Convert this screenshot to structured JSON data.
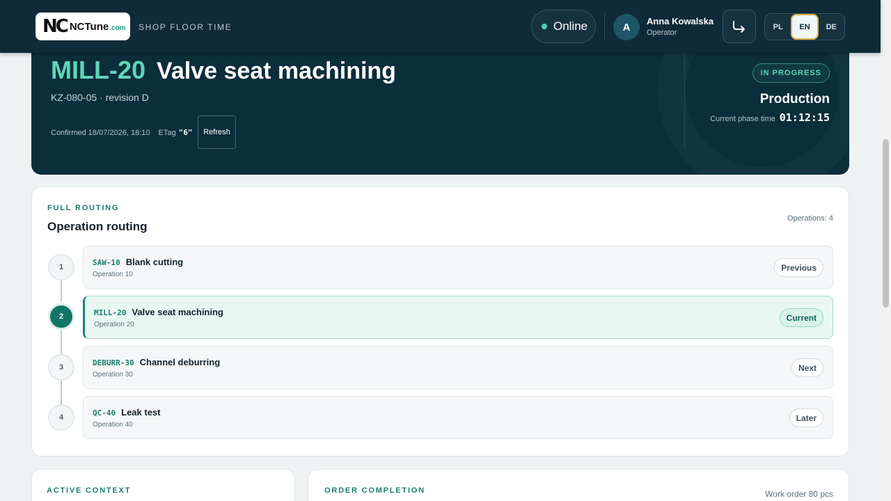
{
  "header": {
    "logo_mark": "NC",
    "logo_text": "NCTune",
    "logo_domain": ".com",
    "subtitle": "SHOP FLOOR TIME",
    "connection_status": "Online",
    "user": {
      "initial": "A",
      "name": "Anna Kowalska",
      "role": "Operator"
    },
    "languages": [
      {
        "code": "PL",
        "active": false
      },
      {
        "code": "EN",
        "active": true
      },
      {
        "code": "DE",
        "active": false
      }
    ]
  },
  "hero": {
    "operation_code": "MILL-20",
    "operation_name": "Valve seat machining",
    "part_info": "KZ-080-05 · revision D",
    "confirmed": "Confirmed 18/07/2026, 18:10",
    "etag_label": "ETag",
    "etag_value": "\"6\"",
    "refresh_label": "Refresh",
    "status": "IN PROGRESS",
    "phase": "Production",
    "phase_time_label": "Current phase time",
    "phase_time": "01:12:15"
  },
  "routing": {
    "eyebrow": "FULL ROUTING",
    "title": "Operation routing",
    "count_label": "Operations: 4",
    "operations": [
      {
        "step": "1",
        "code": "SAW-10",
        "name": "Blank cutting",
        "sub": "Operation 10",
        "badge": "Previous"
      },
      {
        "step": "2",
        "code": "MILL-20",
        "name": "Valve seat machining",
        "sub": "Operation 20",
        "badge": "Current"
      },
      {
        "step": "3",
        "code": "DEBURR-30",
        "name": "Channel deburring",
        "sub": "Operation 30",
        "badge": "Next"
      },
      {
        "step": "4",
        "code": "QC-40",
        "name": "Leak test",
        "sub": "Operation 40",
        "badge": "Later"
      }
    ]
  },
  "context": {
    "eyebrow": "ACTIVE CONTEXT"
  },
  "completion": {
    "eyebrow": "ORDER COMPLETION",
    "work_order": "Work order 80 pcs"
  },
  "colors": {
    "accent": "#1b7c6c",
    "navy": "#0f2a38",
    "status_teal": "#5fd6b8",
    "lang_focus": "#e2b04d"
  }
}
